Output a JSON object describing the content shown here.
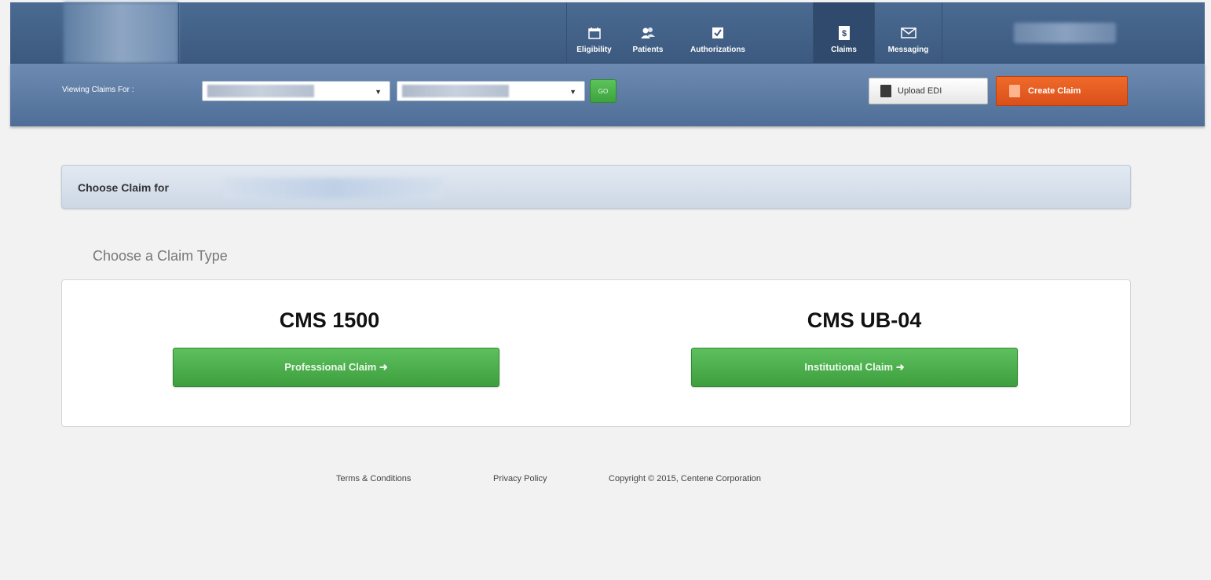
{
  "nav": {
    "tabs": [
      {
        "label": "Eligibility",
        "icon": "calendar-icon"
      },
      {
        "label": "Patients",
        "icon": "users-icon"
      },
      {
        "label": "Authorizations",
        "icon": "checklist-icon"
      },
      {
        "label": "Claims",
        "icon": "dollar-document-icon",
        "active": true
      },
      {
        "label": "Messaging",
        "icon": "envelope-icon"
      }
    ]
  },
  "toolbar": {
    "viewing_label": "Viewing Claims For :",
    "go_label": "GO",
    "upload_label": "Upload EDI",
    "create_label": "Create Claim"
  },
  "panel": {
    "title": "Choose Claim for"
  },
  "claim_type_heading": "Choose a Claim Type",
  "claim_options": [
    {
      "title": "CMS 1500",
      "button": "Professional Claim ➜"
    },
    {
      "title": "CMS UB-04",
      "button": "Institutional Claim ➜"
    }
  ],
  "footer": {
    "terms": "Terms & Conditions",
    "privacy": "Privacy Policy",
    "copyright": "Copyright © 2015, Centene Corporation"
  },
  "colors": {
    "nav_bg": "#4b6a91",
    "subbar_bg": "#6d8bb2",
    "green": "#4caf4c",
    "orange": "#e55d22"
  }
}
